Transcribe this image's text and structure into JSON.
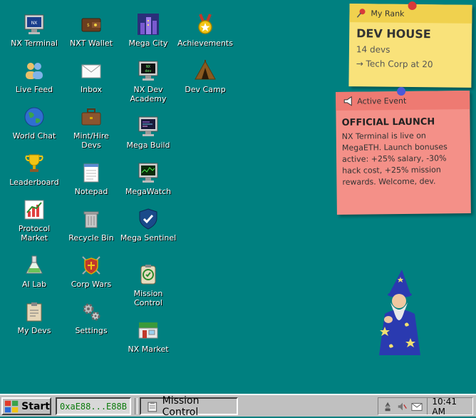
{
  "desktop": {
    "icons": [
      {
        "label": "NX Terminal",
        "icon": "terminal-icon"
      },
      {
        "label": "Live Feed",
        "icon": "users-icon"
      },
      {
        "label": "World Chat",
        "icon": "globe-icon"
      },
      {
        "label": "Leaderboard",
        "icon": "trophy-icon"
      },
      {
        "label": "Protocol Market",
        "icon": "chart-icon"
      },
      {
        "label": "AI Lab",
        "icon": "flask-icon"
      },
      {
        "label": "My Devs",
        "icon": "clipboard-icon"
      },
      {
        "label": "NXT Wallet",
        "icon": "wallet-icon"
      },
      {
        "label": "Inbox",
        "icon": "envelope-icon"
      },
      {
        "label": "Mint/Hire Devs",
        "icon": "briefcase-icon"
      },
      {
        "label": "Notepad",
        "icon": "notepad-icon"
      },
      {
        "label": "Recycle Bin",
        "icon": "trash-icon"
      },
      {
        "label": "Corp Wars",
        "icon": "shield-swords-icon"
      },
      {
        "label": "Settings",
        "icon": "gears-icon"
      },
      {
        "label": "Mega City",
        "icon": "city-icon"
      },
      {
        "label": "NX Dev Academy",
        "icon": "academy-monitor-icon"
      },
      {
        "label": "Mega Build",
        "icon": "build-monitor-icon"
      },
      {
        "label": "MegaWatch",
        "icon": "watch-monitor-icon"
      },
      {
        "label": "Mega Sentinel",
        "icon": "shield-check-icon"
      },
      {
        "label": "Mission Control",
        "icon": "mission-control-icon"
      },
      {
        "label": "NX Market",
        "icon": "market-icon"
      },
      {
        "label": "Achievements",
        "icon": "medal-icon"
      },
      {
        "label": "Dev Camp",
        "icon": "tent-icon"
      }
    ]
  },
  "rank_note": {
    "header": "My Rank",
    "title": "DEV HOUSE",
    "devs": "14 devs",
    "next": "→ Tech Corp at 20"
  },
  "event_note": {
    "header": "Active Event",
    "title": "OFFICIAL LAUNCH",
    "body": "NX Terminal is live on MegaETH. Launch bonuses active: +25% salary, -30% hack cost, +25% mission rewards. Welcome, dev."
  },
  "taskbar": {
    "start_label": "Start",
    "wallet": "0xaE88...E88B",
    "active_task": "Mission Control",
    "clock": "10:41 AM"
  },
  "colors": {
    "desktop": "#008080",
    "rank_note": "#f9e27a",
    "event_note": "#f49088",
    "wallet_text": "#0a7a0a"
  }
}
